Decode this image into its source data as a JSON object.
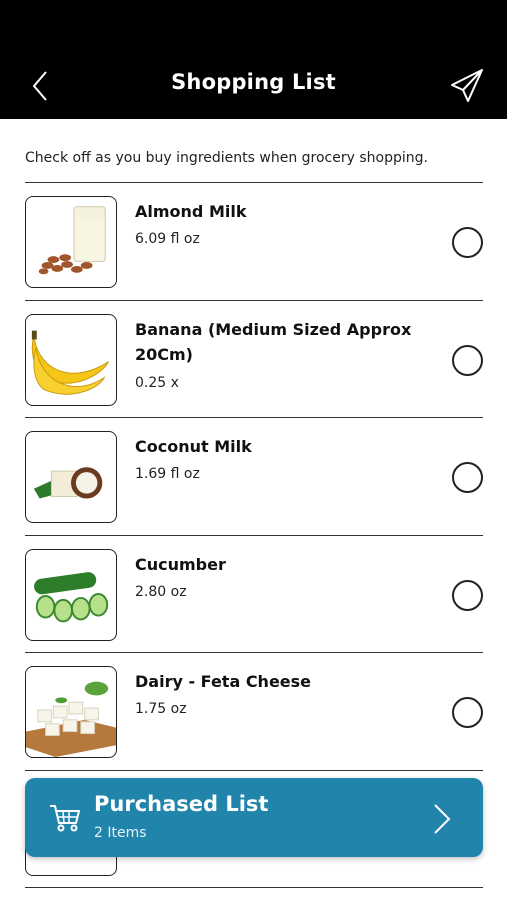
{
  "header": {
    "title": "Shopping List",
    "back_icon": "chevron-left-icon",
    "send_icon": "paper-plane-icon",
    "background": "#000000"
  },
  "instructions": "Check off as you buy ingredients when grocery shopping.",
  "items": [
    {
      "name": "Almond Milk",
      "quantity": "6.09 fl oz",
      "image": "almond-milk-image",
      "checked": false
    },
    {
      "name": "Banana (Medium Sized Approx 20Cm)",
      "quantity": "0.25 x",
      "image": "banana-image",
      "checked": false
    },
    {
      "name": "Coconut Milk",
      "quantity": "1.69 fl oz",
      "image": "coconut-milk-image",
      "checked": false
    },
    {
      "name": "Cucumber",
      "quantity": "2.80 oz",
      "image": "cucumber-image",
      "checked": false
    },
    {
      "name": "Dairy - Feta Cheese",
      "quantity": "1.75 oz",
      "image": "feta-cheese-image",
      "checked": false
    }
  ],
  "purchased": {
    "title": "Purchased List",
    "count": "2 Items",
    "icon": "shopping-cart-icon",
    "color": "#2184ab"
  }
}
